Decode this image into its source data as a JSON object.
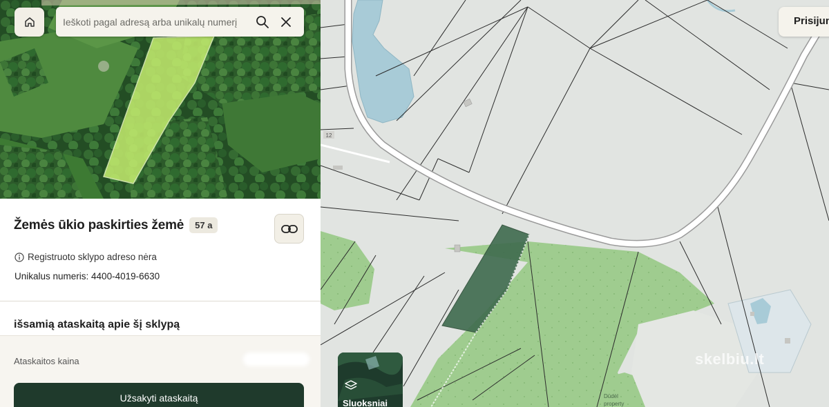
{
  "search": {
    "placeholder": "Ieškoti pagal adresą arba unikalų numerį"
  },
  "parcel": {
    "title": "Žemės ūkio paskirties žemė",
    "area_badge": "57 a",
    "address_note": "Registruoto sklypo adreso nėra",
    "unique_number": "Unikalus numeris: 4400-4019-6630"
  },
  "report": {
    "heading": "išsamią ataskaitą apie šį sklypą",
    "price_label": "Ataskaitos kaina",
    "order_button": "Užsakyti ataskaitą"
  },
  "map": {
    "login_button": "Prisijungti",
    "layers_button": "Sluoksniai",
    "watermark": "skelbiu.lt",
    "labels": {
      "road_number": "12",
      "small_label": "Dūdėl",
      "small_label_2": "property"
    }
  },
  "icons": {
    "home": "home-icon",
    "search": "search-icon",
    "clear": "close-icon",
    "link": "link-icon",
    "info": "info-icon",
    "layers": "layers-icon"
  },
  "colors": {
    "accent_dark_green": "#1f3a2c",
    "parcel_highlight_aerial": "#c4ec6e",
    "parcel_highlight_map": "#3f6b4e",
    "forest_map": "#9fcc8f",
    "water_map": "#a8cbd7"
  }
}
